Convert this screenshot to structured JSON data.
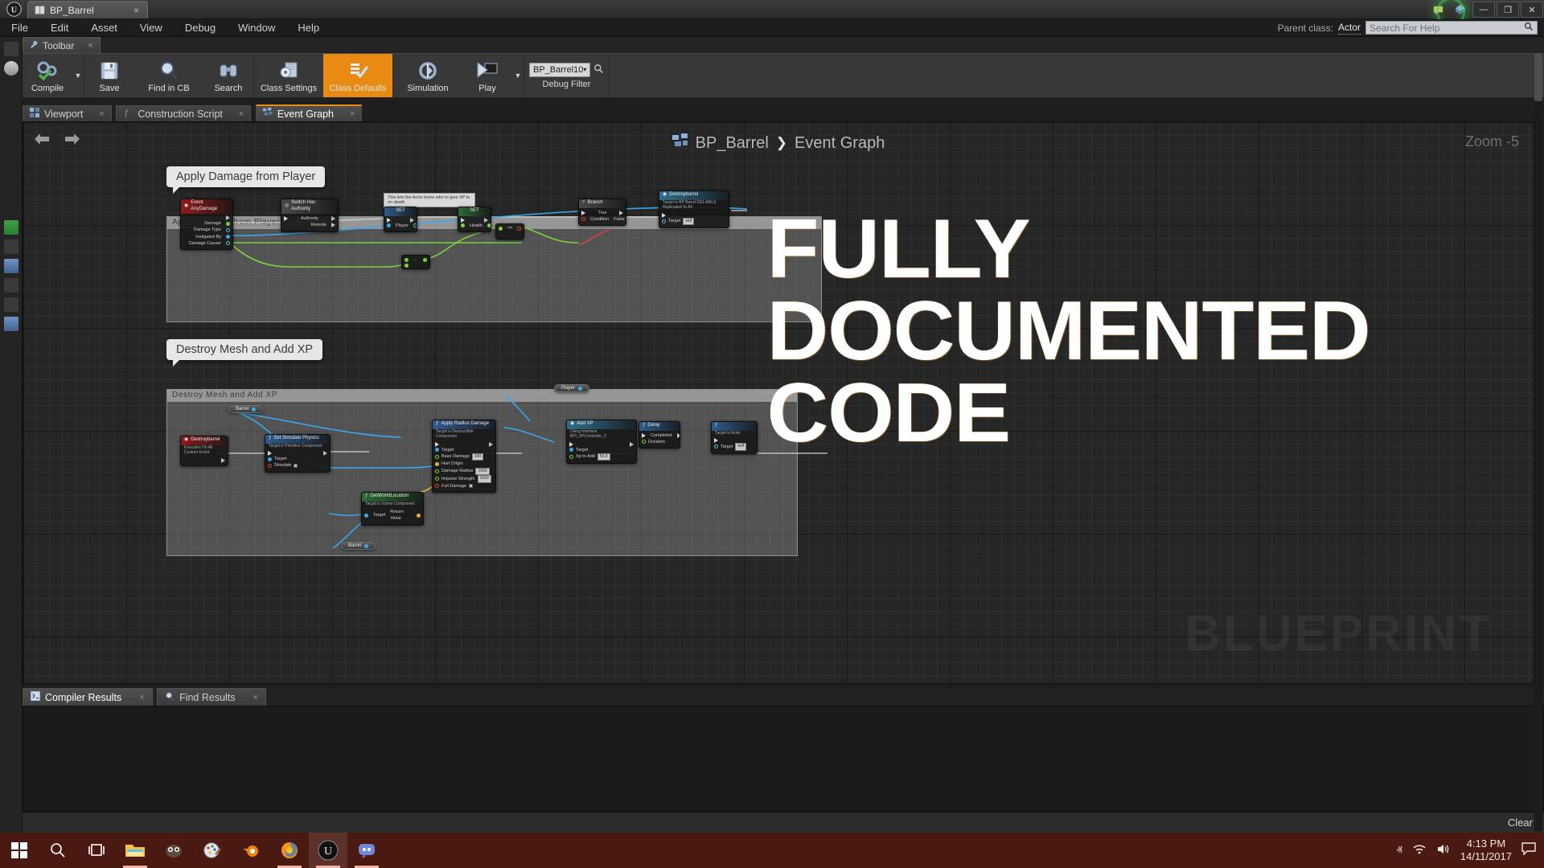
{
  "titlebar": {
    "app_icon": "unreal-logo",
    "tab_label": "BP_Barrel",
    "tab_close": "×",
    "comment_icon": "feedback-icon",
    "marketplace_icon": "marketplace-icon",
    "minimize": "—",
    "restore": "❐",
    "close": "✕"
  },
  "menubar": {
    "items": [
      "File",
      "Edit",
      "Asset",
      "View",
      "Debug",
      "Window",
      "Help"
    ],
    "parent_class_label": "Parent class:",
    "parent_class_value": "Actor",
    "help_placeholder": "Search For Help",
    "help_value": "",
    "search_icon": "magnifier-icon"
  },
  "toolbar_panel": {
    "tab_label": "Toolbar",
    "tab_icon": "wrench-icon",
    "tab_close": "×",
    "buttons": [
      {
        "label": "Compile",
        "icon": "compile-gears-check-icon",
        "active": false,
        "caret": true
      },
      {
        "label": "Save",
        "icon": "floppy-disk-icon",
        "active": false,
        "caret": false
      },
      {
        "label": "Find in CB",
        "icon": "magnifier-icon",
        "active": false,
        "caret": false
      },
      {
        "label": "Search",
        "icon": "binoculars-icon",
        "active": false,
        "caret": false
      },
      {
        "label": "Class Settings",
        "icon": "class-settings-gear-icon",
        "active": false,
        "caret": false
      },
      {
        "label": "Class Defaults",
        "icon": "class-defaults-checklist-icon",
        "active": true,
        "caret": false
      },
      {
        "label": "Simulation",
        "icon": "simulation-gear-icon",
        "active": false,
        "caret": false
      },
      {
        "label": "Play",
        "icon": "play-triangle-icon",
        "active": false,
        "caret": true
      }
    ],
    "debug": {
      "combo_value": "BP_Barrel10",
      "combo_caret": "▾",
      "magnifier_icon": "magnifier-icon",
      "label": "Debug Filter"
    }
  },
  "graph_tabs": [
    {
      "label": "Viewport",
      "icon": "viewport-grid-icon",
      "active": false,
      "close": "×"
    },
    {
      "label": "Construction Script",
      "icon": "function-f-icon",
      "active": false,
      "close": "×"
    },
    {
      "label": "Event Graph",
      "icon": "event-graph-icon",
      "active": true,
      "close": "×"
    }
  ],
  "graph": {
    "back_icon": "arrow-left-icon",
    "forward_icon": "arrow-right-icon",
    "breadcrumb_icon": "event-graph-icon",
    "breadcrumb_root": "BP_Barrel",
    "breadcrumb_sep": "❯",
    "breadcrumb_leaf": "Event Graph",
    "zoom_label": "Zoom  -5",
    "watermark": "BLUEPRINT",
    "tooltips": [
      {
        "text": "Apply Damage from Player"
      },
      {
        "text": "Destroy Mesh and Add XP"
      }
    ],
    "comments": [
      {
        "title": "Apply Damage from Player"
      },
      {
        "title": "Destroy Mesh and Add XP"
      }
    ],
    "sticky_note": "This lets the Actor know who to give XP to on death",
    "nodes_graph1": [
      {
        "title": "Event AnyDamage",
        "subtitle": "",
        "header": "red",
        "icon": "event-icon",
        "inputs": [],
        "outputs": [
          {
            "label": "",
            "pin": "exec-o"
          },
          {
            "label": "Damage",
            "pin": "green"
          },
          {
            "label": "Damage Type",
            "pin": "cyan"
          },
          {
            "label": "Instigated By",
            "pin": "blue"
          },
          {
            "label": "Damage Causer",
            "pin": "cyan"
          }
        ]
      },
      {
        "title": "Switch Has Authority",
        "subtitle": "",
        "header": "grey",
        "icon": "switch-icon",
        "inputs": [
          {
            "label": "",
            "pin": "exec"
          }
        ],
        "outputs": [
          {
            "label": "Authority",
            "pin": "exec-o"
          },
          {
            "label": "Remote",
            "pin": "exec-o"
          }
        ]
      },
      {
        "title": "SET",
        "subtitle": "",
        "header": "blue",
        "icon": "",
        "inputs": [
          {
            "label": "",
            "pin": "exec"
          },
          {
            "label": "Player",
            "pin": "blue"
          }
        ],
        "outputs": [
          {
            "label": "",
            "pin": "exec-o"
          },
          {
            "label": "",
            "pin": "cyan"
          }
        ]
      },
      {
        "title": "SET",
        "subtitle": "",
        "header": "green",
        "icon": "",
        "inputs": [
          {
            "label": "",
            "pin": "exec"
          },
          {
            "label": "Health",
            "pin": "green"
          }
        ],
        "outputs": [
          {
            "label": "",
            "pin": "exec-o"
          },
          {
            "label": "",
            "pin": "green"
          }
        ]
      },
      {
        "title": "Branch",
        "subtitle": "",
        "header": "grey",
        "icon": "branch-icon",
        "inputs": [
          {
            "label": "",
            "pin": "exec"
          },
          {
            "label": "Condition",
            "pin": "red"
          }
        ],
        "outputs": [
          {
            "label": "True",
            "pin": "exec-o"
          },
          {
            "label": "False",
            "pin": "exec-o"
          }
        ]
      },
      {
        "title": "Destroybarrel",
        "subtitle": "Target is BP Barrel\nRELIABLE Replicated To All",
        "header": "cyan",
        "icon": "event-icon",
        "inputs": [
          {
            "label": "",
            "pin": "exec"
          },
          {
            "label": "Target",
            "pin": "cyan",
            "value": "self"
          }
        ],
        "outputs": []
      }
    ],
    "nodes_graph2": [
      {
        "title": "Barrel",
        "type": "variable",
        "pin": "blue"
      },
      {
        "title": "Barrel",
        "type": "variable",
        "pin": "blue"
      },
      {
        "title": "Player",
        "type": "variable",
        "pin": "blue"
      },
      {
        "title": "Destroybarrel",
        "subtitle": "Executes On All\nCustom Event",
        "header": "red",
        "icon": "event-icon",
        "inputs": [],
        "outputs": [
          {
            "label": "",
            "pin": "exec-o"
          }
        ]
      },
      {
        "title": "Set Simulate Physics",
        "subtitle": "Target is Primitive Component",
        "header": "blue",
        "icon": "function-f-icon",
        "inputs": [
          {
            "label": "",
            "pin": "exec"
          },
          {
            "label": "Target",
            "pin": "blue"
          },
          {
            "label": "Simulate",
            "pin": "red",
            "checkbox": true
          }
        ],
        "outputs": [
          {
            "label": "",
            "pin": "exec-o"
          }
        ]
      },
      {
        "title": "GetWorldLocation",
        "subtitle": "Target is Scene Component",
        "header": "green",
        "icon": "function-f-icon",
        "inputs": [
          {
            "label": "Target",
            "pin": "blue"
          }
        ],
        "outputs": [
          {
            "label": "Return Value",
            "pin": "yellow"
          }
        ]
      },
      {
        "title": "Apply Radius Damage",
        "subtitle": "Target is Destructible Component",
        "header": "blue",
        "icon": "function-f-icon",
        "inputs": [
          {
            "label": "",
            "pin": "exec"
          },
          {
            "label": "Target",
            "pin": "blue"
          },
          {
            "label": "Base Damage",
            "pin": "greenring",
            "value": "100"
          },
          {
            "label": "Hurt Origin",
            "pin": "yellow"
          },
          {
            "label": "Damage Radius",
            "pin": "greenring",
            "value": "1000"
          },
          {
            "label": "Impulse Strength",
            "pin": "greenring",
            "value": "1000"
          },
          {
            "label": "Full Damage",
            "pin": "red",
            "checkbox": true
          }
        ],
        "outputs": [
          {
            "label": "",
            "pin": "exec-o"
          }
        ]
      },
      {
        "title": "Add XP",
        "subtitle": "Using Interface BPI_XPController_C",
        "header": "cyan",
        "icon": "event-icon",
        "inputs": [
          {
            "label": "",
            "pin": "exec"
          },
          {
            "label": "Target",
            "pin": "blue"
          },
          {
            "label": "Xp to Add",
            "pin": "greenring",
            "value": "50.0"
          }
        ],
        "outputs": [
          {
            "label": "",
            "pin": "exec-o"
          }
        ]
      },
      {
        "title": "Delay",
        "subtitle": "",
        "header": "blue",
        "icon": "function-f-icon",
        "inputs": [
          {
            "label": "",
            "pin": "exec"
          },
          {
            "label": "Duration",
            "pin": "greenring"
          }
        ],
        "outputs": [
          {
            "label": "Completed",
            "pin": "exec-o"
          }
        ]
      },
      {
        "title": "",
        "subtitle": "Target is Actor",
        "header": "blue",
        "icon": "function-f-icon",
        "inputs": [
          {
            "label": "",
            "pin": "exec"
          },
          {
            "label": "Target",
            "pin": "cyan",
            "value": "self"
          }
        ],
        "outputs": []
      }
    ]
  },
  "overlay": {
    "line1": "Fully",
    "line2": "Documented",
    "line3": "Code"
  },
  "bottom_panel": {
    "tabs": [
      {
        "label": "Compiler Results",
        "icon": "console-icon",
        "active": true,
        "close": "×"
      },
      {
        "label": "Find Results",
        "icon": "magnifier-icon",
        "active": false,
        "close": "×"
      }
    ],
    "clear_label": "Clear"
  },
  "taskbar": {
    "icons": [
      {
        "name": "start-button",
        "glyph": "windows-logo"
      },
      {
        "name": "search-button",
        "glyph": "magnifier"
      },
      {
        "name": "task-view-button",
        "glyph": "taskview"
      },
      {
        "name": "file-explorer",
        "glyph": "folder",
        "running": true
      },
      {
        "name": "gimp",
        "glyph": "gimp",
        "running": false
      },
      {
        "name": "paint",
        "glyph": "paint",
        "running": false
      },
      {
        "name": "blender",
        "glyph": "blender",
        "running": false
      },
      {
        "name": "firefox",
        "glyph": "firefox",
        "running": true
      },
      {
        "name": "unreal-engine",
        "glyph": "unreal",
        "running": true,
        "active": true
      },
      {
        "name": "discord",
        "glyph": "discord",
        "running": true
      }
    ],
    "tray": {
      "chevron": "ⱏ",
      "network_icon": "wifi-icon",
      "volume_icon": "speaker-icon",
      "time": "4:13 PM",
      "date": "14/11/2017",
      "notification_icon": "notification-icon"
    }
  }
}
